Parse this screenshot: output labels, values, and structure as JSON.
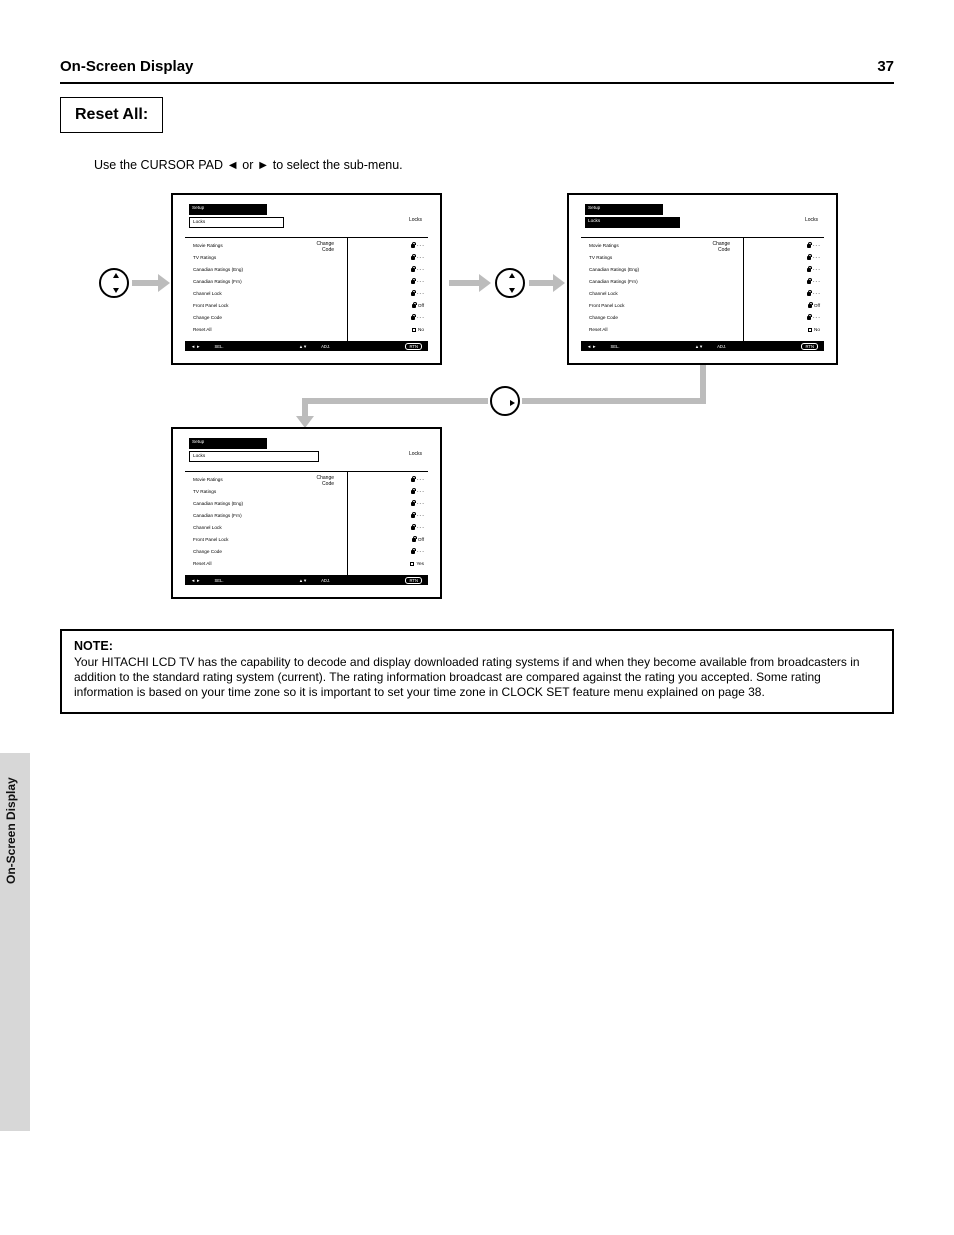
{
  "page": {
    "header_title": "On-Screen Display",
    "page_number": "37",
    "subsection_label": "Reset All:",
    "lead_line": "Use the CURSOR PAD ◄ or ► to select the sub-menu.",
    "side_tab": "On-Screen Display"
  },
  "osd": {
    "tab_setup": "Setup",
    "tab_locks": "Locks",
    "caption_locks": "Locks",
    "side_caption": "Change\nCode",
    "footer_select": "SEL.",
    "footer_sel_arrows": "◄ ►",
    "footer_adj": "ADJ.",
    "footer_adj_arrows": "▲▼",
    "footer_rtn_pill": "RTN",
    "rows": {
      "movie_ratings": {
        "label": "Movie Ratings",
        "value": "- - -"
      },
      "tv_ratings": {
        "label": "TV Ratings",
        "value": "- - -"
      },
      "ca_eng": {
        "label": "Canadian Ratings (Eng)",
        "value": "- - -"
      },
      "ca_frn": {
        "label": "Canadian Ratings (Frn)",
        "value": "- - -"
      },
      "channel_lock": {
        "label": "Channel Lock",
        "value": "- - -"
      },
      "front_panel_lock": {
        "label": "Front Panel Lock",
        "value": "Off"
      },
      "change_code": {
        "label": "Change Code",
        "value": "- - -"
      },
      "reset_all": {
        "label": "Reset All",
        "value_no": "No",
        "value_yes": "Yes"
      }
    }
  },
  "note": {
    "label": "NOTE:",
    "body": "Your HITACHI LCD TV has the capability to decode and display downloaded rating systems if and when they become available from broadcasters in addition to the standard rating system (current). The rating information broadcast are compared against the rating you accepted. Some rating information is based on your time zone so it is important to set your time zone in CLOCK SET feature menu explained on page 38."
  }
}
